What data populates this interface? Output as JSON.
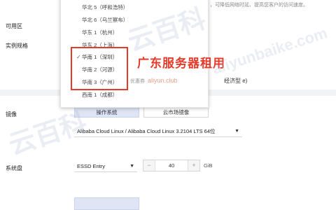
{
  "labels": {
    "zone": "可用区",
    "spec": "实例规格",
    "image": "镜像",
    "system_disk": "系统盘"
  },
  "hint_text": "，可降低网络时延、提高您客户的访问速度。",
  "spec_partial": "经济型 e)",
  "region_dropdown": {
    "items": [
      {
        "label": "华北 5（呼和浩特）"
      },
      {
        "label": "华北 6（乌兰察布）"
      },
      {
        "label": "华东 1（杭州）"
      },
      {
        "label": "华东 2（上海）"
      },
      {
        "label": "华南 1（深圳）",
        "selected": true
      },
      {
        "label": "华南 2（河源）"
      },
      {
        "label": "华南 3（广州）"
      },
      {
        "label": "西南 1（成都）"
      }
    ]
  },
  "promo": {
    "title": "广东服务器租用",
    "coupon_label": "优惠券",
    "coupon_url": "aliyun.club"
  },
  "image_tabs": {
    "os_label": "操作系统",
    "market_label": "云市场镜像"
  },
  "os_select": {
    "value": "Alibaba Cloud Linux / Alibaba Cloud Linux 3.2104 LTS 64位"
  },
  "disk": {
    "type": "ESSD Entry",
    "size": "40",
    "unit": "GiB"
  },
  "watermarks": [
    "云百科",
    "aliyunbaike.com",
    "云百科"
  ],
  "colors": {
    "accent_red": "#e53b2c",
    "tab_active": "#dfe5f4"
  }
}
